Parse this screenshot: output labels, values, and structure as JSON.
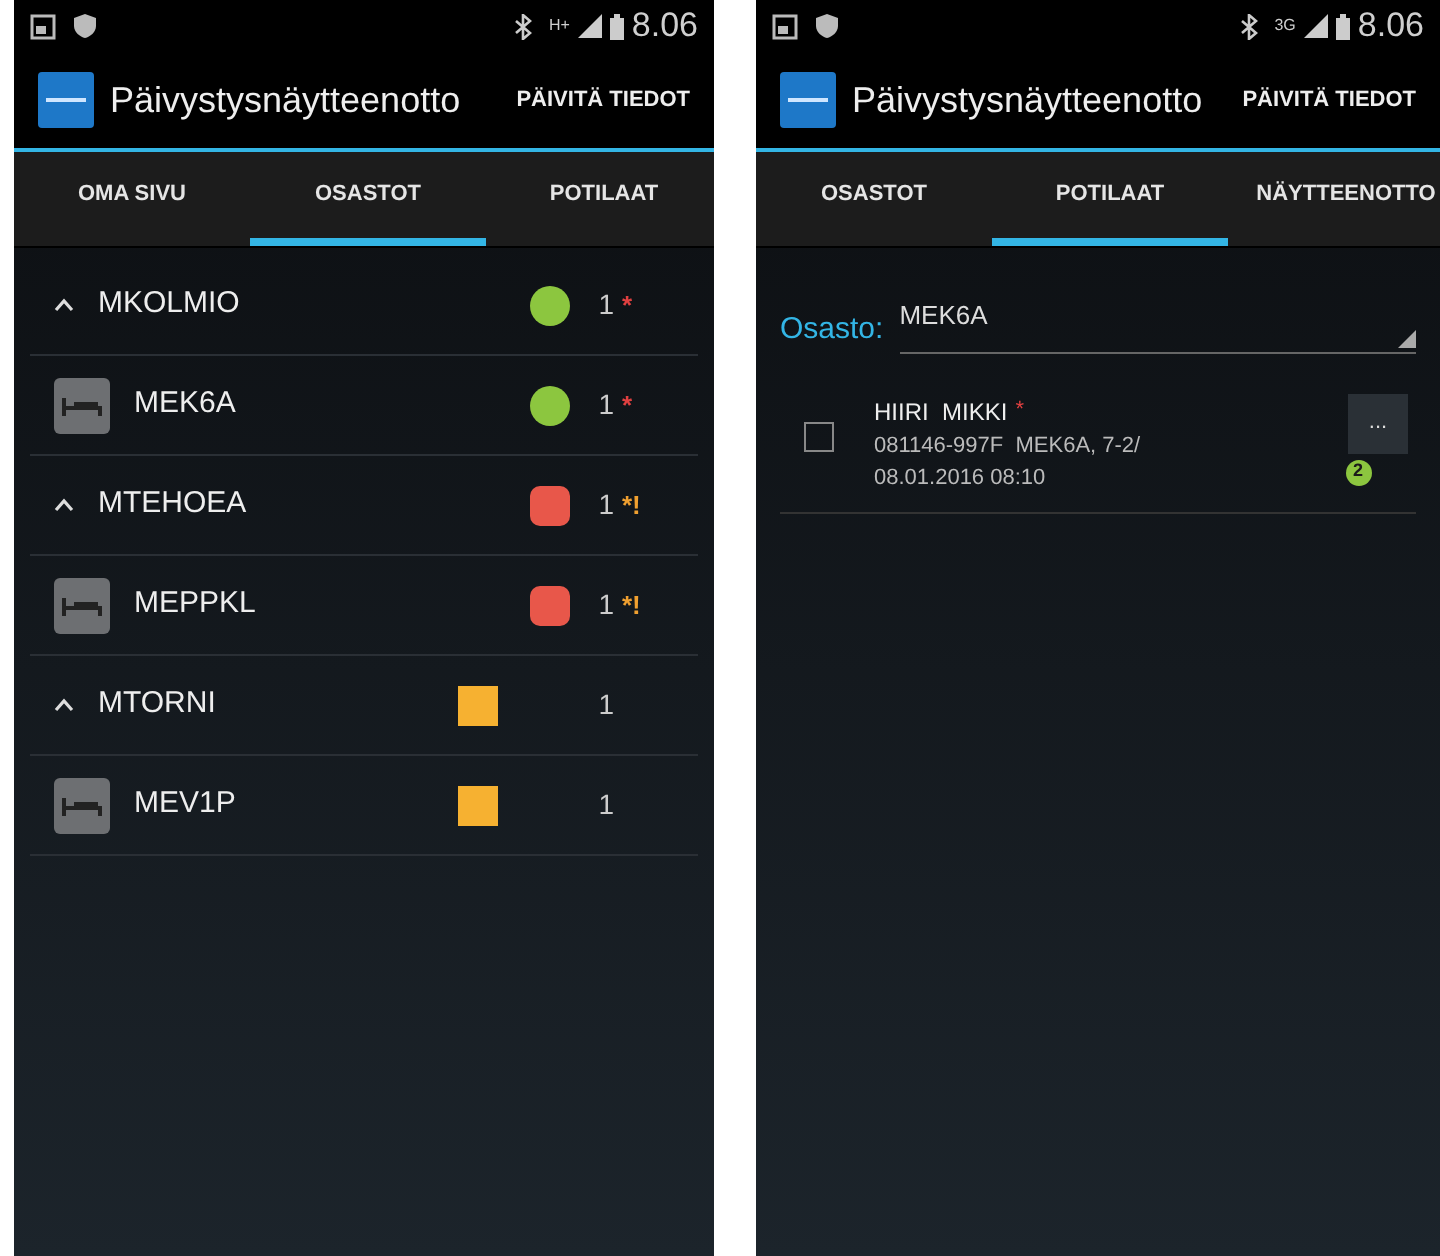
{
  "screens": [
    {
      "status_bar": {
        "network": "H+",
        "time": "8.06"
      },
      "app_bar": {
        "title": "Päivystysnäytteenotto",
        "action": "PÄIVITÄ TIEDOT"
      },
      "tabs": [
        {
          "label": "OMA SIVU",
          "selected": false
        },
        {
          "label": "OSASTOT",
          "selected": true
        },
        {
          "label": "POTILAAT",
          "selected": false
        }
      ],
      "departments": [
        {
          "name": "MKOLMIO",
          "expanded": true,
          "kind": "circle",
          "color": "#8cc63f",
          "count": "1",
          "flag": {
            "text": "*",
            "color": "#e04040"
          },
          "children": [
            {
              "name": "MEK6A",
              "kind": "circle",
              "color": "#8cc63f",
              "count": "1",
              "flag": {
                "text": "*",
                "color": "#e04040"
              }
            }
          ]
        },
        {
          "name": "MTEHOEA",
          "expanded": true,
          "kind": "rounded",
          "color": "#e8574a",
          "count": "1",
          "flag": {
            "text": "*!",
            "color": "#f0a030"
          },
          "children": [
            {
              "name": "MEPPKL",
              "kind": "rounded",
              "color": "#e8574a",
              "count": "1",
              "flag": {
                "text": "*!",
                "color": "#f0a030"
              }
            }
          ]
        },
        {
          "name": "MTORNI",
          "expanded": true,
          "kind": "square",
          "color": "#f6b131",
          "count": "1",
          "children": [
            {
              "name": "MEV1P",
              "kind": "square",
              "color": "#f6b131",
              "count": "1"
            }
          ]
        }
      ]
    },
    {
      "status_bar": {
        "network": "3G",
        "time": "8.06"
      },
      "app_bar": {
        "title": "Päivystysnäytteenotto",
        "action": "PÄIVITÄ TIEDOT"
      },
      "tabs": [
        {
          "label": "OSASTOT",
          "selected": false
        },
        {
          "label": "POTILAAT",
          "selected": true
        },
        {
          "label": "NÄYTTEENOTTO",
          "selected": false
        }
      ],
      "filter": {
        "label": "Osasto:",
        "value": "MEK6A"
      },
      "patients": [
        {
          "name": "HIIRI  MIKKI",
          "mark": "*",
          "details": "081146-997F  MEK6A, 7-2/",
          "time": "08.01.2016 08:10",
          "checked": false,
          "button": "...",
          "badge": "2"
        }
      ]
    }
  ]
}
